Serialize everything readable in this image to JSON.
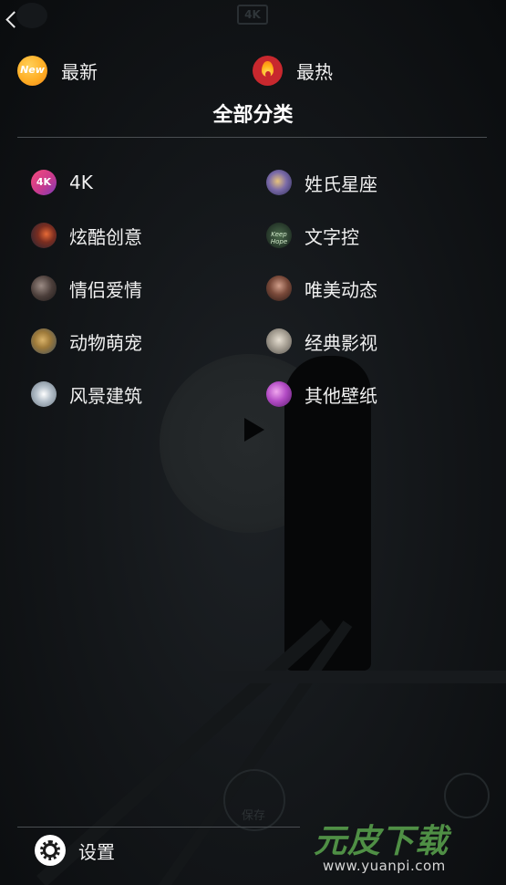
{
  "background": {
    "badge_4k": "4K",
    "save_label": "保存"
  },
  "quick_entries": [
    {
      "label": "最新",
      "icon": "new-badge-icon",
      "icon_text": "New"
    },
    {
      "label": "最热",
      "icon": "flame-icon"
    }
  ],
  "section_title": "全部分类",
  "categories": [
    {
      "label": "4K",
      "icon": "4k-icon",
      "icon_text": "4K"
    },
    {
      "label": "姓氏星座",
      "icon": "surname-zodiac-thumb-icon"
    },
    {
      "label": "炫酷创意",
      "icon": "cool-creative-thumb-icon"
    },
    {
      "label": "文字控",
      "icon": "text-thumb-icon",
      "icon_text": "Keep Hope"
    },
    {
      "label": "情侣爱情",
      "icon": "couple-thumb-icon"
    },
    {
      "label": "唯美动态",
      "icon": "aesthetic-dynamic-thumb-icon"
    },
    {
      "label": "动物萌宠",
      "icon": "animal-pet-thumb-icon"
    },
    {
      "label": "经典影视",
      "icon": "classic-movie-thumb-icon"
    },
    {
      "label": "风景建筑",
      "icon": "scenery-architecture-thumb-icon"
    },
    {
      "label": "其他壁纸",
      "icon": "other-wallpaper-thumb-icon"
    }
  ],
  "footer": {
    "settings_label": "设置",
    "settings_icon": "gear-icon"
  },
  "watermark": {
    "title": "元皮下载",
    "url": "www.yuanpi.com"
  }
}
